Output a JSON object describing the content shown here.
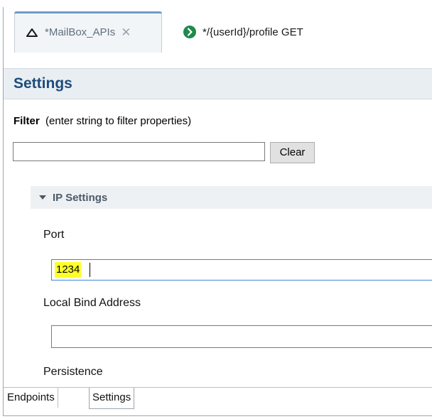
{
  "tabs": [
    {
      "label": "*MailBox_APIs",
      "icon": "cloud-icon",
      "active": true,
      "closable": true
    },
    {
      "label": "*/{userId}/profile GET",
      "icon": "go-arrow-icon",
      "active": false
    }
  ],
  "settings": {
    "title": "Settings",
    "filter": {
      "label": "Filter",
      "hint": "(enter string to filter properties)",
      "value": "",
      "clear_label": "Clear"
    },
    "section": {
      "title": "IP Settings",
      "expanded": true,
      "fields": {
        "port": {
          "label": "Port",
          "value": "1234"
        },
        "local_bind_address": {
          "label": "Local Bind Address",
          "value": ""
        },
        "persistence": {
          "label": "Persistence"
        }
      }
    }
  },
  "bottom_tabs": [
    "Endpoints",
    "Settings"
  ],
  "colors": {
    "accent_blue": "#1d4c7a",
    "highlight_yellow": "#ffff2a",
    "focus_border": "#3c87d4",
    "go_icon_green": "#1f8a4c"
  }
}
